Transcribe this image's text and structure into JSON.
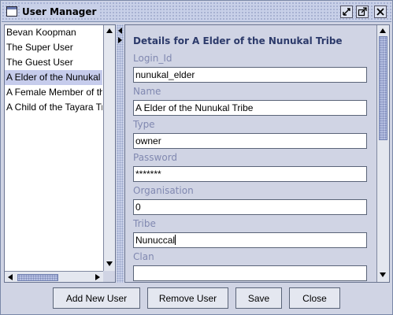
{
  "window": {
    "title": "User Manager",
    "icons": [
      "window-icon",
      "iconify-icon",
      "maximize-icon",
      "close-icon"
    ]
  },
  "user_list": {
    "items": [
      {
        "label": "Bevan Koopman",
        "selected": false
      },
      {
        "label": "The Super User",
        "selected": false
      },
      {
        "label": "The Guest User",
        "selected": false
      },
      {
        "label": "A Elder of the Nunukal Tribe",
        "selected": true
      },
      {
        "label": "A Female Member of the Nunukal Tribe",
        "selected": false
      },
      {
        "label": "A Child of the Tayara Tribe",
        "selected": false
      }
    ]
  },
  "details": {
    "heading": "Details for A Elder of the Nunukal Tribe",
    "fields": [
      {
        "label": "Login_Id",
        "value": "nunukal_elder"
      },
      {
        "label": "Name",
        "value": "A Elder of the Nunukal Tribe"
      },
      {
        "label": "Type",
        "value": "owner"
      },
      {
        "label": "Password",
        "value": "*******"
      },
      {
        "label": "Organisation",
        "value": "0"
      },
      {
        "label": "Tribe",
        "value": "Nunuccal"
      },
      {
        "label": "Clan",
        "value": ""
      }
    ]
  },
  "buttons": {
    "add": "Add New User",
    "remove": "Remove User",
    "save": "Save",
    "close": "Close"
  },
  "colors": {
    "selection": "#c6ccec",
    "heading": "#2c3a6a",
    "field_label": "#8088b0",
    "panel_bg": "#d0d4e4"
  }
}
